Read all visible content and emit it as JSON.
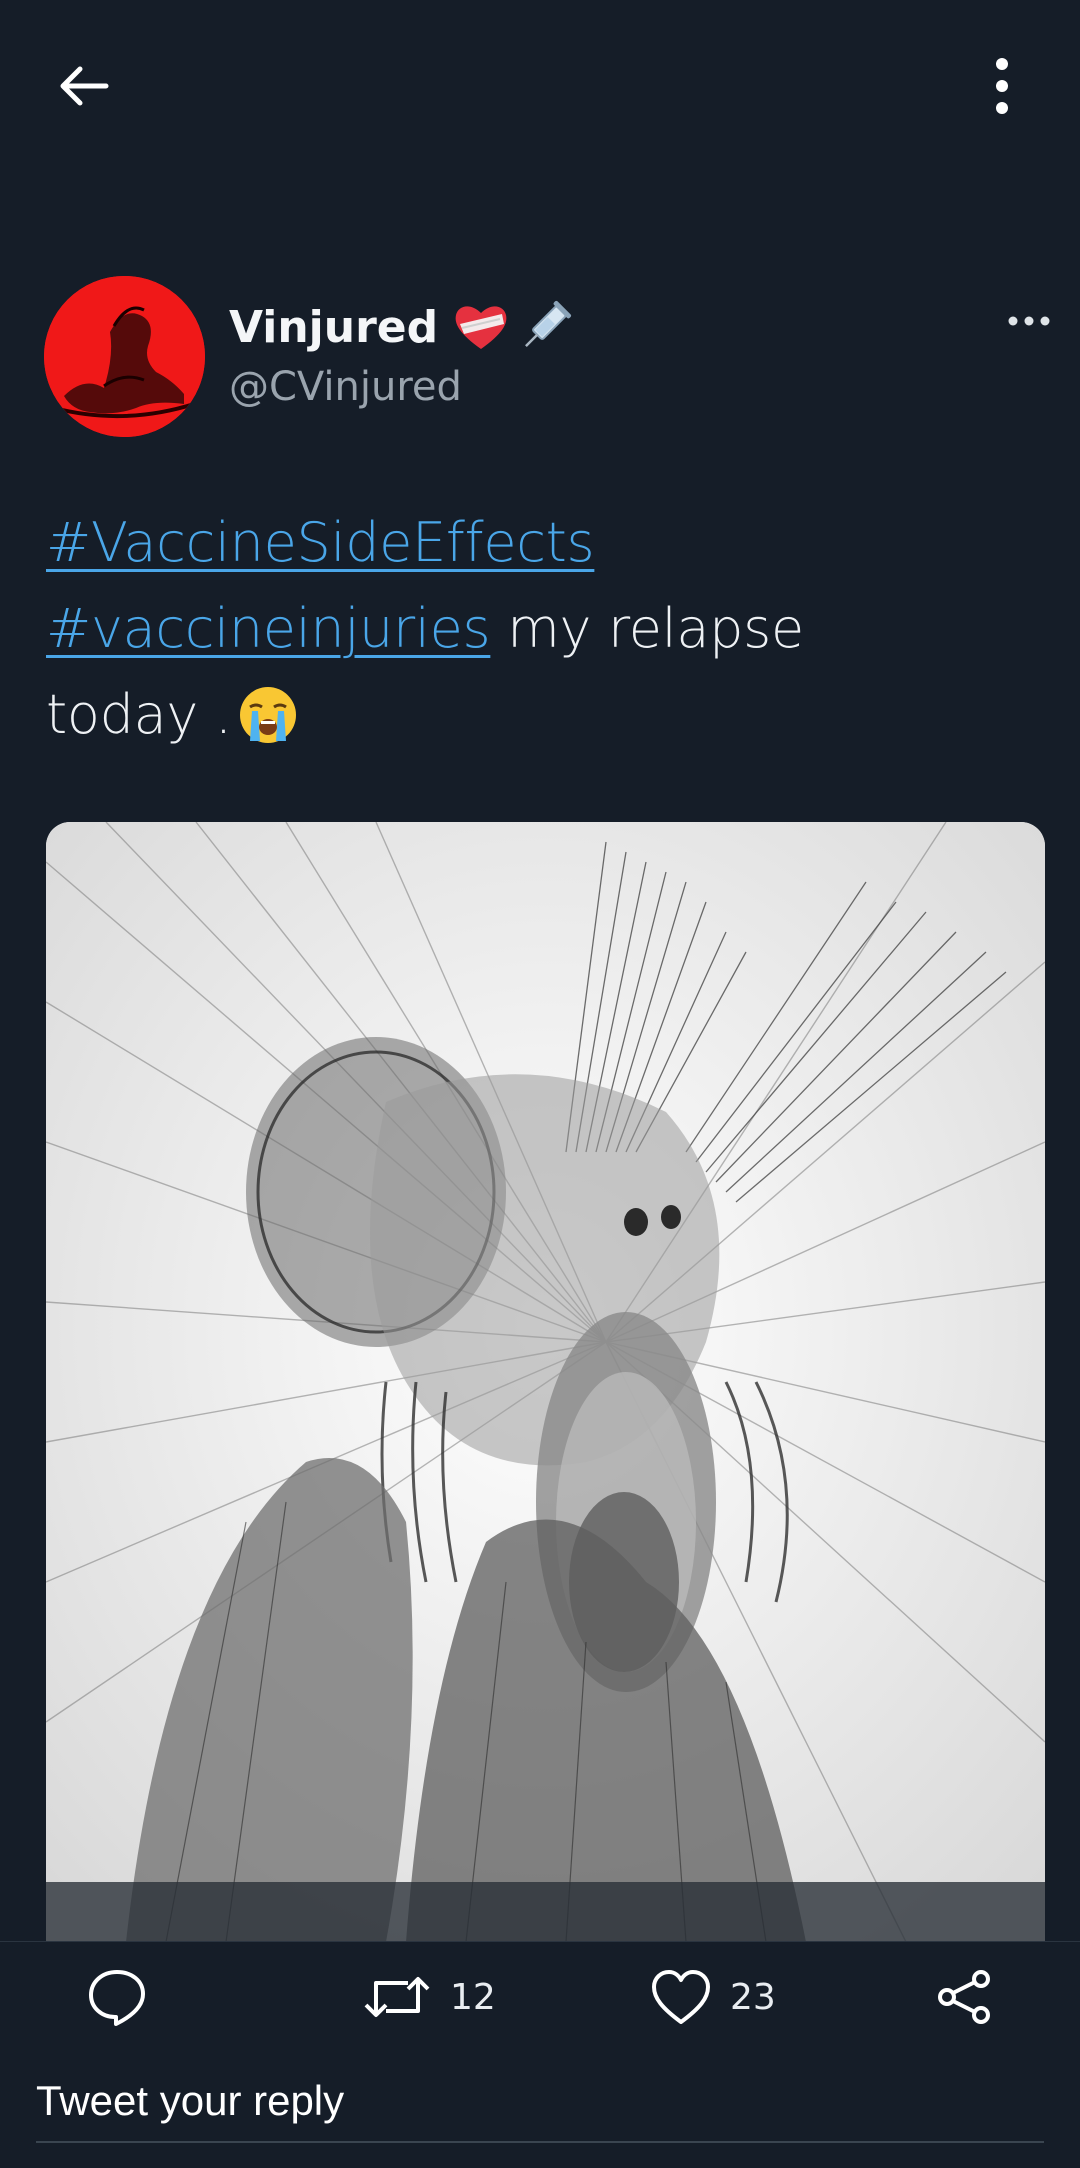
{
  "topbar": {
    "back_icon": "arrow-left-icon",
    "menu_icon": "vertical-ellipsis-icon"
  },
  "author": {
    "name": "Vinjured",
    "handle": "@CVinjured",
    "name_emojis": [
      "mending-heart-emoji",
      "syringe-emoji"
    ],
    "more_icon": "horizontal-ellipsis-icon"
  },
  "tweet": {
    "hashtag1": "#VaccineSideEffects",
    "hashtag2": "#vaccineinjuries",
    "text_after_hashtag2": " my relapse",
    "line3": "today .",
    "emoji": "loudly-crying-face-emoji"
  },
  "media": {
    "subject": "pencil-sketch-screaming-figure"
  },
  "actions": {
    "reply_icon": "comment-icon",
    "retweet_icon": "retweet-icon",
    "retweet_count": "12",
    "like_icon": "heart-icon",
    "like_count": "23",
    "share_icon": "share-icon"
  },
  "reply": {
    "placeholder": "Tweet your reply"
  },
  "colors": {
    "background": "#151d28",
    "hashtag": "#4aa6e8",
    "handle": "#9aa4ae",
    "avatar_red": "#ff1e1e"
  }
}
